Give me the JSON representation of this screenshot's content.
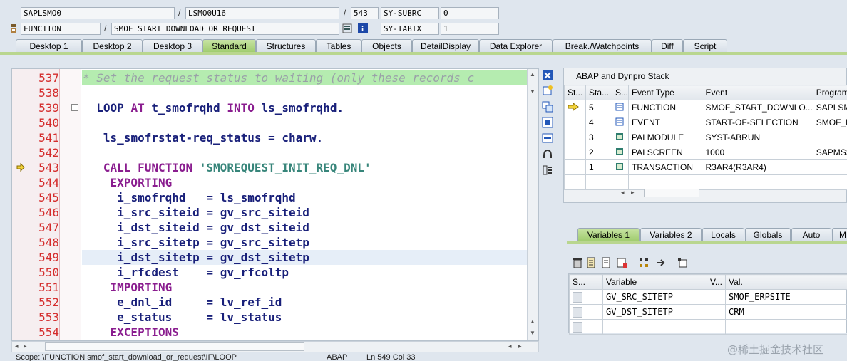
{
  "header": {
    "row1": {
      "program": "SAPLSMO0",
      "include": "LSMO0U16",
      "line": "543",
      "sysvar": "SY-SUBRC",
      "sysval": "0"
    },
    "row2": {
      "type": "FUNCTION",
      "name": "SMOF_START_DOWNLOAD_OR_REQUEST",
      "sysvar": "SY-TABIX",
      "sysval": "1"
    }
  },
  "tabs": [
    "Desktop 1",
    "Desktop 2",
    "Desktop 3",
    "Standard",
    "Structures",
    "Tables",
    "Objects",
    "DetailDisplay",
    "Data Explorer",
    "Break./Watchpoints",
    "Diff",
    "Script"
  ],
  "active_tab": "Standard",
  "editor": {
    "lines": [
      {
        "n": "537",
        "seg": [
          [
            "cmt",
            "* Set the request status to waiting (only these records c"
          ]
        ]
      },
      {
        "n": "538",
        "seg": []
      },
      {
        "n": "539",
        "seg": [
          [
            "",
            "  "
          ],
          [
            "id",
            "LOOP"
          ],
          [
            "",
            " "
          ],
          [
            "kw",
            "AT"
          ],
          [
            "",
            " "
          ],
          [
            "id",
            "t_smofrqhd"
          ],
          [
            "",
            " "
          ],
          [
            "kw",
            "INTO"
          ],
          [
            "",
            " "
          ],
          [
            "id",
            "ls_smofrqhd."
          ]
        ]
      },
      {
        "n": "540",
        "seg": []
      },
      {
        "n": "541",
        "seg": [
          [
            "",
            "   "
          ],
          [
            "id",
            "ls_smofrstat-req_status"
          ],
          [
            "",
            " "
          ],
          [
            "id",
            "="
          ],
          [
            "",
            " "
          ],
          [
            "id",
            "charw."
          ]
        ]
      },
      {
        "n": "542",
        "seg": []
      },
      {
        "n": "543",
        "seg": [
          [
            "",
            "   "
          ],
          [
            "kw",
            "CALL FUNCTION"
          ],
          [
            "",
            " "
          ],
          [
            "str",
            "'SMOREQUEST_INIT_REQ_DNL'"
          ]
        ]
      },
      {
        "n": "544",
        "seg": [
          [
            "",
            "    "
          ],
          [
            "kw",
            "EXPORTING"
          ]
        ]
      },
      {
        "n": "545",
        "seg": [
          [
            "",
            "     "
          ],
          [
            "id",
            "i_smofrqhd"
          ],
          [
            "",
            "   "
          ],
          [
            "id",
            "="
          ],
          [
            "",
            " "
          ],
          [
            "id",
            "ls_smofrqhd"
          ]
        ]
      },
      {
        "n": "546",
        "seg": [
          [
            "",
            "     "
          ],
          [
            "id",
            "i_src_siteid"
          ],
          [
            "",
            " "
          ],
          [
            "id",
            "="
          ],
          [
            "",
            " "
          ],
          [
            "id",
            "gv_src_siteid"
          ]
        ]
      },
      {
        "n": "547",
        "seg": [
          [
            "",
            "     "
          ],
          [
            "id",
            "i_dst_siteid"
          ],
          [
            "",
            " "
          ],
          [
            "id",
            "="
          ],
          [
            "",
            " "
          ],
          [
            "id",
            "gv_dst_siteid"
          ]
        ]
      },
      {
        "n": "548",
        "seg": [
          [
            "",
            "     "
          ],
          [
            "id",
            "i_src_sitetp"
          ],
          [
            "",
            " "
          ],
          [
            "id",
            "="
          ],
          [
            "",
            " "
          ],
          [
            "id",
            "gv_src_sitetp"
          ]
        ]
      },
      {
        "n": "549",
        "seg": [
          [
            "",
            "     "
          ],
          [
            "id",
            "i_dst_sitetp"
          ],
          [
            "",
            " "
          ],
          [
            "id",
            "="
          ],
          [
            "",
            " "
          ],
          [
            "id",
            "gv_dst_sitetp"
          ]
        ]
      },
      {
        "n": "550",
        "seg": [
          [
            "",
            "     "
          ],
          [
            "id",
            "i_rfcdest"
          ],
          [
            "",
            "    "
          ],
          [
            "id",
            "="
          ],
          [
            "",
            " "
          ],
          [
            "id",
            "gv_rfcoltp"
          ]
        ]
      },
      {
        "n": "551",
        "seg": [
          [
            "",
            "    "
          ],
          [
            "kw",
            "IMPORTING"
          ]
        ]
      },
      {
        "n": "552",
        "seg": [
          [
            "",
            "     "
          ],
          [
            "id",
            "e_dnl_id"
          ],
          [
            "",
            "     "
          ],
          [
            "id",
            "="
          ],
          [
            "",
            " "
          ],
          [
            "id",
            "lv_ref_id"
          ]
        ]
      },
      {
        "n": "553",
        "seg": [
          [
            "",
            "     "
          ],
          [
            "id",
            "e_status"
          ],
          [
            "",
            "     "
          ],
          [
            "id",
            "="
          ],
          [
            "",
            " "
          ],
          [
            "id",
            "lv_status"
          ]
        ]
      },
      {
        "n": "554",
        "seg": [
          [
            "",
            "    "
          ],
          [
            "kw",
            "EXCEPTIONS"
          ]
        ]
      }
    ],
    "current_line": "543",
    "highlight_line": "549"
  },
  "status_bar": {
    "scope": "Scope: \\FUNCTION smof_start_download_or_request\\IF\\LOOP",
    "lang": "ABAP",
    "pos": "Ln 549 Col 33"
  },
  "stack": {
    "title": "ABAP and Dynpro Stack",
    "columns": [
      "St...",
      "Sta...",
      "S...",
      "Event Type",
      "Event",
      "Program"
    ],
    "rows": [
      {
        "current": true,
        "level": "5",
        "type": "FUNCTION",
        "event": "SMOF_START_DOWNLO...",
        "program": "SAPLSMO"
      },
      {
        "current": false,
        "level": "4",
        "type": "EVENT",
        "event": "START-OF-SELECTION",
        "program": "SMOF_RE"
      },
      {
        "current": false,
        "level": "3",
        "type": "PAI MODULE",
        "event": "SYST-ABRUN",
        "program": ""
      },
      {
        "current": false,
        "level": "2",
        "type": "PAI SCREEN",
        "event": "1000",
        "program": "SAPMSSY"
      },
      {
        "current": false,
        "level": "1",
        "type": "TRANSACTION",
        "event": "R3AR4(R3AR4)",
        "program": ""
      }
    ]
  },
  "var_tabs": [
    "Variables 1",
    "Variables 2",
    "Locals",
    "Globals",
    "Auto",
    "M"
  ],
  "variables": {
    "columns": [
      "S...",
      "Variable",
      "V...",
      "Val."
    ],
    "rows": [
      {
        "name": "GV_SRC_SITETP",
        "value": "SMOF_ERPSITE"
      },
      {
        "name": "GV_DST_SITETP",
        "value": "CRM"
      }
    ]
  },
  "watermark": "@稀土掘金技术社区",
  "colors": {
    "accent_tab": "#9ecb6c",
    "line_number": "#d42b2b",
    "keyword": "#8a1d8f",
    "identifier": "#19207a",
    "string": "#37857a",
    "comment_bg": "#b5ecb0"
  }
}
